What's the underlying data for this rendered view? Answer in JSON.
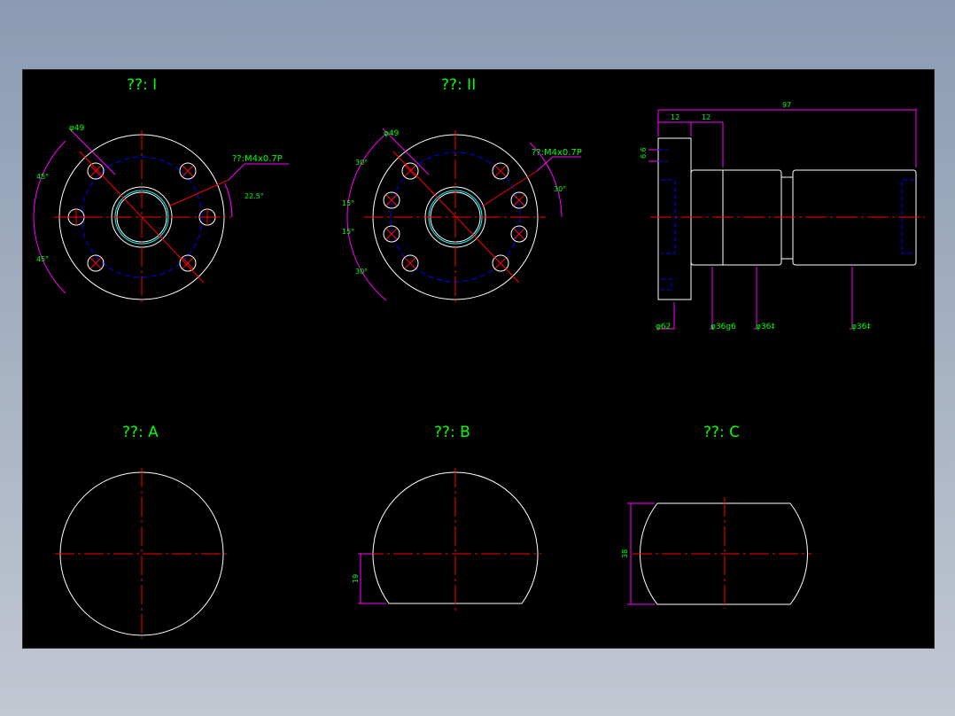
{
  "colors": {
    "background": "#000000",
    "outline": "#ffffff",
    "centerline": "#ff0000",
    "hidden": "#0000ff",
    "dimension": "#ff00ff",
    "text": "#00ff00",
    "thread": "#00ffff"
  },
  "views": {
    "view1": {
      "title": "??: I",
      "dia": "φ49",
      "thread": "??:M4x0.7P",
      "ang_top": "45°",
      "ang_bottom": "45°",
      "ang_right": "22.5°"
    },
    "view2": {
      "title": "??: II",
      "dia": "φ49",
      "thread": "??:M4x0.7P",
      "ang1": "30°",
      "ang2": "15°",
      "ang3": "15°",
      "ang4": "30°",
      "ang_right": "30°"
    },
    "side": {
      "dim_total": "97",
      "dim_flange": "12",
      "dim_step": "12",
      "dim_thick": "6.6",
      "d1": "φ62",
      "d2": "φ36g6",
      "d3": "φ36‡",
      "d4": "φ36‡"
    },
    "viewA": {
      "title": "??: A"
    },
    "viewB": {
      "title": "??: B",
      "dim": "19"
    },
    "viewC": {
      "title": "??: C",
      "dim": "38"
    }
  }
}
